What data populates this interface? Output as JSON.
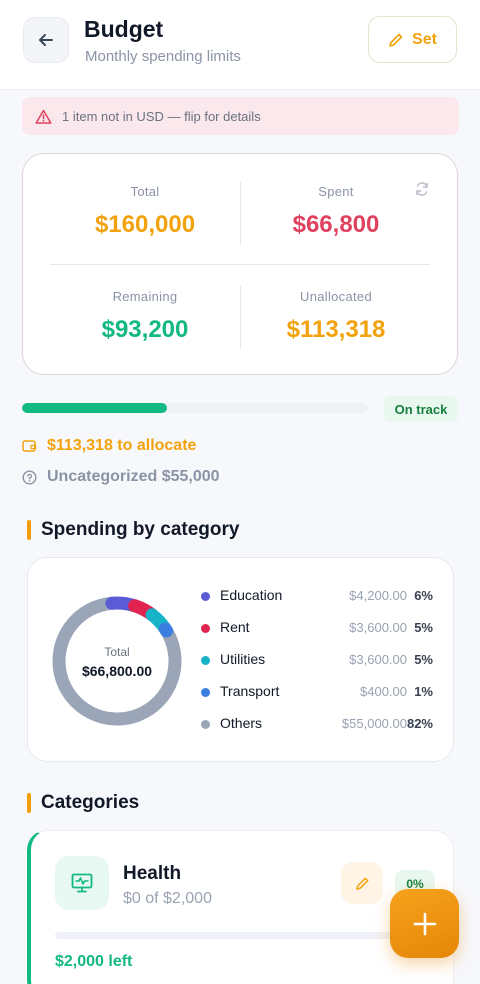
{
  "header": {
    "title": "Budget",
    "subtitle": "Monthly spending limits",
    "back_icon": "arrow-left-icon",
    "set_label": "Set",
    "set_icon": "pencil-icon"
  },
  "alert": {
    "text": "1 item not in USD — flip for details",
    "icon": "warning-triangle-icon",
    "color": "#e0415f"
  },
  "summary": {
    "total_label": "Total",
    "total_value": "$160,000",
    "spent_label": "Spent",
    "spent_value": "$66,800",
    "remaining_label": "Remaining",
    "remaining_value": "$93,200",
    "unallocated_label": "Unallocated",
    "unallocated_value": "$113,318",
    "colors": {
      "total": "#f2a20c",
      "spent": "#e0415f",
      "remaining": "#12b981",
      "unallocated": "#f2a20c"
    }
  },
  "progress": {
    "fraction": 0.42,
    "status": "On track"
  },
  "allocate_text": "$113,318 to allocate",
  "uncategorized_text": "Uncategorized $55,000",
  "spending_section": {
    "title": "Spending by category",
    "center_label": "Total",
    "center_value": "$66,800.00",
    "legend": [
      {
        "name": "Education",
        "amount": "$4,200.00",
        "percent": "6%",
        "color": "#5b5bd6",
        "share": 6.3
      },
      {
        "name": "Rent",
        "amount": "$3,600.00",
        "percent": "5%",
        "color": "#e0244f",
        "share": 5.4
      },
      {
        "name": "Utilities",
        "amount": "$3,600.00",
        "percent": "5%",
        "color": "#16b3c9",
        "share": 5.4
      },
      {
        "name": "Transport",
        "amount": "$400.00",
        "percent": "1%",
        "color": "#3b7de0",
        "share": 0.6
      },
      {
        "name": "Others",
        "amount": "$55,000.00",
        "percent": "82%",
        "color": "#9aa5b8",
        "share": 82.3
      }
    ]
  },
  "categories_section": {
    "title": "Categories",
    "items": [
      {
        "name": "Health",
        "sub": "$0 of $2,000",
        "percent": "0%",
        "left": "$2,000 left",
        "icon": "monitor-health-icon",
        "fraction": 0
      }
    ]
  },
  "fab_icon": "plus-icon"
}
